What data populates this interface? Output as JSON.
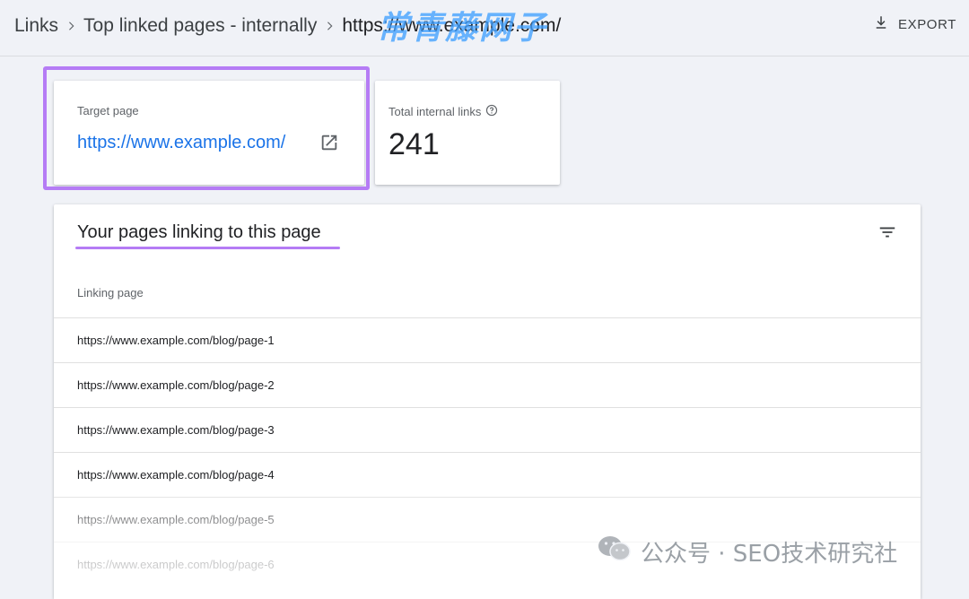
{
  "breadcrumb": {
    "items": [
      "Links",
      "Top linked pages - internally",
      "https://www.example.com/"
    ]
  },
  "header": {
    "export_label": "EXPORT",
    "watermark_text": "常青藤网子"
  },
  "target_card": {
    "label": "Target page",
    "url": "https://www.example.com/"
  },
  "total_card": {
    "label": "Total internal links",
    "value": "241"
  },
  "table": {
    "title": "Your pages linking to this page",
    "column_header": "Linking page",
    "rows": [
      "https://www.example.com/blog/page-1",
      "https://www.example.com/blog/page-2",
      "https://www.example.com/blog/page-3",
      "https://www.example.com/blog/page-4",
      "https://www.example.com/blog/page-5",
      "https://www.example.com/blog/page-6"
    ]
  },
  "footer_watermark": {
    "text": "公众号 · SEO技术研究社"
  },
  "colors": {
    "accent_purple": "#b57cf5",
    "link_blue": "#1a73e8",
    "background": "#f0f2f7"
  },
  "icons": [
    "chevron-right-icon",
    "download-icon",
    "open-in-new-icon",
    "help-circle-icon",
    "filter-icon",
    "wechat-icon"
  ]
}
